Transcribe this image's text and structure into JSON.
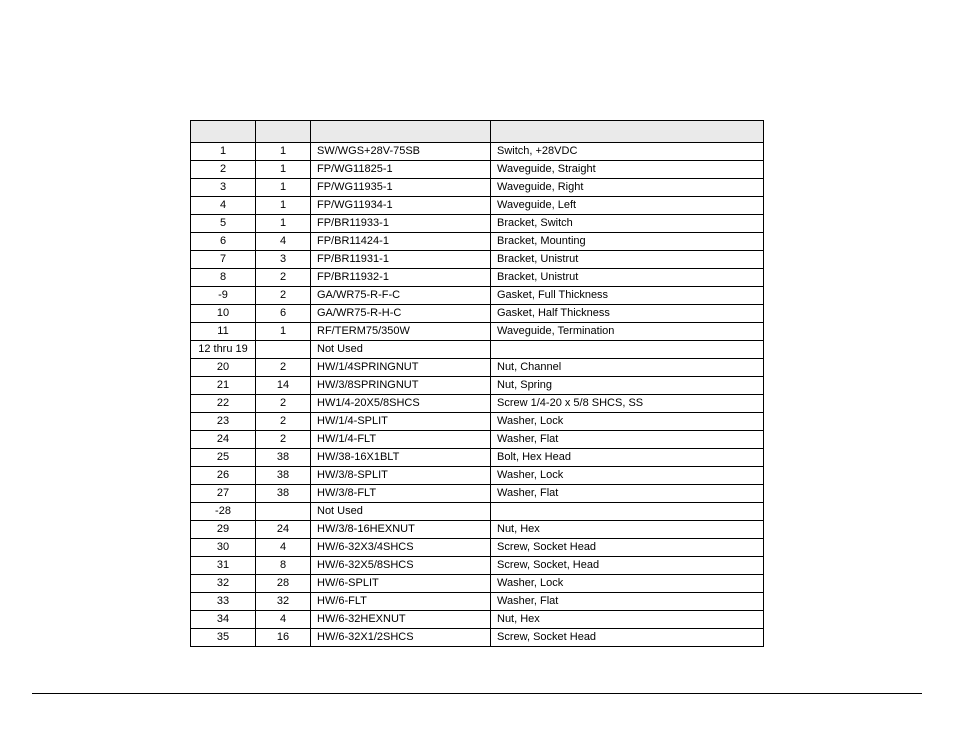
{
  "table": {
    "headers": [
      "",
      "",
      "",
      ""
    ],
    "rows": [
      {
        "item": "1",
        "qty": "1",
        "part": "SW/WGS+28V-75SB",
        "desc": "Switch, +28VDC"
      },
      {
        "item": "2",
        "qty": "1",
        "part": "FP/WG11825-1",
        "desc": "Waveguide, Straight"
      },
      {
        "item": "3",
        "qty": "1",
        "part": "FP/WG11935-1",
        "desc": "Waveguide, Right"
      },
      {
        "item": "4",
        "qty": "1",
        "part": "FP/WG11934-1",
        "desc": "Waveguide, Left"
      },
      {
        "item": "5",
        "qty": "1",
        "part": "FP/BR11933-1",
        "desc": "Bracket, Switch"
      },
      {
        "item": "6",
        "qty": "4",
        "part": "FP/BR11424-1",
        "desc": "Bracket, Mounting"
      },
      {
        "item": "7",
        "qty": "3",
        "part": "FP/BR11931-1",
        "desc": "Bracket, Unistrut"
      },
      {
        "item": "8",
        "qty": "2",
        "part": "FP/BR11932-1",
        "desc": "Bracket, Unistrut"
      },
      {
        "item": "-9",
        "qty": "2",
        "part": "GA/WR75-R-F-C",
        "desc": "Gasket, Full Thickness"
      },
      {
        "item": "10",
        "qty": "6",
        "part": "GA/WR75-R-H-C",
        "desc": "Gasket, Half Thickness"
      },
      {
        "item": "11",
        "qty": "1",
        "part": "RF/TERM75/350W",
        "desc": "Waveguide, Termination"
      },
      {
        "item": "12 thru 19",
        "qty": "",
        "part": "Not Used",
        "desc": ""
      },
      {
        "item": "20",
        "qty": "2",
        "part": "HW/1/4SPRINGNUT",
        "desc": "Nut, Channel"
      },
      {
        "item": "21",
        "qty": "14",
        "part": "HW/3/8SPRINGNUT",
        "desc": "Nut, Spring"
      },
      {
        "item": "22",
        "qty": "2",
        "part": "HW1/4-20X5/8SHCS",
        "desc": "Screw 1/4-20 x 5/8 SHCS, SS"
      },
      {
        "item": "23",
        "qty": "2",
        "part": "HW/1/4-SPLIT",
        "desc": "Washer, Lock"
      },
      {
        "item": "24",
        "qty": "2",
        "part": "HW/1/4-FLT",
        "desc": "Washer, Flat"
      },
      {
        "item": "25",
        "qty": "38",
        "part": "HW/38-16X1BLT",
        "desc": "Bolt, Hex Head"
      },
      {
        "item": "26",
        "qty": "38",
        "part": "HW/3/8-SPLIT",
        "desc": "Washer, Lock"
      },
      {
        "item": "27",
        "qty": "38",
        "part": "HW/3/8-FLT",
        "desc": "Washer, Flat"
      },
      {
        "item": "-28",
        "qty": "",
        "part": "Not Used",
        "desc": ""
      },
      {
        "item": "29",
        "qty": "24",
        "part": "HW/3/8-16HEXNUT",
        "desc": "Nut, Hex"
      },
      {
        "item": "30",
        "qty": "4",
        "part": "HW/6-32X3/4SHCS",
        "desc": "Screw, Socket Head"
      },
      {
        "item": "31",
        "qty": "8",
        "part": "HW/6-32X5/8SHCS",
        "desc": "Screw, Socket, Head"
      },
      {
        "item": "32",
        "qty": "28",
        "part": "HW/6-SPLIT",
        "desc": "Washer, Lock"
      },
      {
        "item": "33",
        "qty": "32",
        "part": "HW/6-FLT",
        "desc": "Washer, Flat"
      },
      {
        "item": "34",
        "qty": "4",
        "part": "HW/6-32HEXNUT",
        "desc": "Nut, Hex"
      },
      {
        "item": "35",
        "qty": "16",
        "part": "HW/6-32X1/2SHCS",
        "desc": "Screw, Socket Head"
      }
    ]
  }
}
